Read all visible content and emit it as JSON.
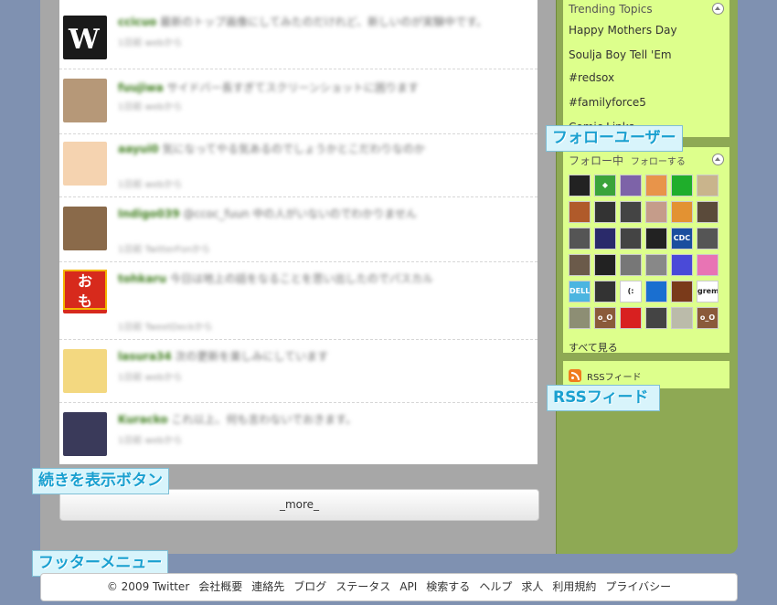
{
  "timeline": {
    "tweets": [
      {
        "user": "ccicuo",
        "text": "最新のトップ画像にしてみたのだけれど、新しいのが実験中です。",
        "meta": "1日前 webから"
      },
      {
        "user": "fuujiwa",
        "text": "サイドバー長すぎてスクリーンショットに困ります",
        "meta": "1日前 webから"
      },
      {
        "user": "aayui0",
        "text": "気になってやる気あるのでしょうかとこだわりなのか",
        "meta": "1日前 webから"
      },
      {
        "user": "Indigo039",
        "text": "@ccoc_fuun 中の人がいないのでわかりません",
        "meta": "1日前 TwitterFonから"
      },
      {
        "user": "tohkaru",
        "text": "今日は地上の話をなることを思い出したのでパスカル",
        "meta": "1日前 TweetDeckから"
      },
      {
        "user": "lasura34",
        "text": "次の更新を楽しみにしています",
        "meta": "1日前 webから"
      },
      {
        "user": "Kuracko",
        "text": "これ以上、何も言わないでおきます。",
        "meta": "1日前 webから"
      }
    ],
    "more_label": "_more_"
  },
  "sidebar": {
    "trending": {
      "title": "Trending Topics",
      "items": [
        "Happy Mothers Day",
        "Soulja Boy Tell 'Em",
        "#redsox",
        "#familyforce5",
        "Comic Links"
      ]
    },
    "following": {
      "title": "フォロー中",
      "follow_link": "フォローする",
      "see_all": "すべて見る",
      "friends": [
        {
          "label": "",
          "color": "#222"
        },
        {
          "label": "◆",
          "color": "#3aa33a"
        },
        {
          "label": "",
          "color": "#7d63a8"
        },
        {
          "label": "",
          "color": "#e8944a"
        },
        {
          "label": "",
          "color": "#1fae2b"
        },
        {
          "label": "",
          "color": "#c9b48c"
        },
        {
          "label": "",
          "color": "#b05a2a"
        },
        {
          "label": "",
          "color": "#333"
        },
        {
          "label": "",
          "color": "#444"
        },
        {
          "label": "",
          "color": "#c59c8a"
        },
        {
          "label": "",
          "color": "#e39232"
        },
        {
          "label": "",
          "color": "#5a4a3a"
        },
        {
          "label": "",
          "color": "#555"
        },
        {
          "label": "",
          "color": "#2a2a6a"
        },
        {
          "label": "",
          "color": "#444"
        },
        {
          "label": "",
          "color": "#222"
        },
        {
          "label": "CDC",
          "color": "#1a4e9e"
        },
        {
          "label": "",
          "color": "#555"
        },
        {
          "label": "",
          "color": "#6b5a4a"
        },
        {
          "label": "",
          "color": "#222"
        },
        {
          "label": "",
          "color": "#777"
        },
        {
          "label": "",
          "color": "#888"
        },
        {
          "label": "",
          "color": "#4a4ad8"
        },
        {
          "label": "",
          "color": "#e874b4"
        },
        {
          "label": "DELL",
          "color": "#4bb5e0"
        },
        {
          "label": "",
          "color": "#333"
        },
        {
          "label": "(:",
          "color": "#ffffff"
        },
        {
          "label": "",
          "color": "#1a6fd0"
        },
        {
          "label": "",
          "color": "#7a3a1a"
        },
        {
          "label": "gremz",
          "color": "#ffffff"
        },
        {
          "label": "",
          "color": "#8d8e74"
        },
        {
          "label": "o_O",
          "color": "#8a5a3a"
        },
        {
          "label": "",
          "color": "#d82020"
        },
        {
          "label": "",
          "color": "#444"
        },
        {
          "label": "",
          "color": "#bba"
        },
        {
          "label": "o_O",
          "color": "#8a5a3a"
        }
      ]
    },
    "rss": {
      "label": "RSSフィード"
    }
  },
  "annotations": {
    "follow_users": "フォローユーザー",
    "rss_feed": "RSSフィード",
    "more_button": "続きを表示ボタン",
    "footer_menu": "フッターメニュー"
  },
  "footer": {
    "items": [
      "© 2009 Twitter",
      "会社概要",
      "連絡先",
      "ブログ",
      "ステータス",
      "API",
      "検索する",
      "ヘルプ",
      "求人",
      "利用規約",
      "プライバシー"
    ]
  }
}
